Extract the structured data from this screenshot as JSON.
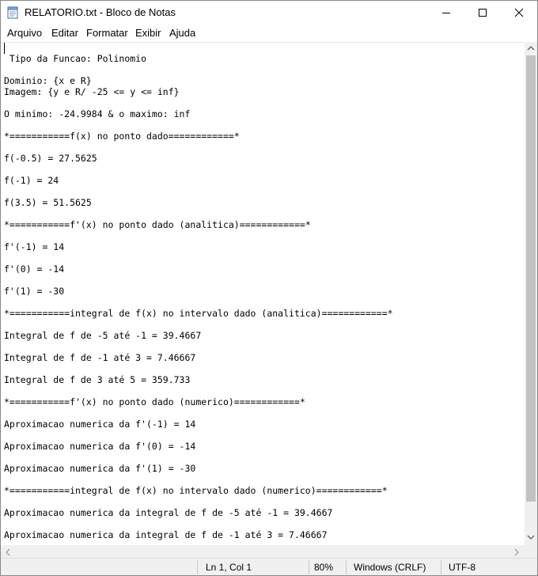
{
  "window": {
    "title": "RELATORIO.txt - Bloco de Notas",
    "icon": "notepad-icon",
    "controls": [
      "minimize-icon",
      "maximize-icon",
      "close-icon"
    ]
  },
  "menu": [
    "Arquivo",
    "Editar",
    "Formatar",
    "Exibir",
    "Ajuda"
  ],
  "editor": {
    "lines": [
      " Tipo da Funcao: Polinomio",
      "Dominio: {x e R}",
      "Imagem: {y e R/ -25 <= y <= inf}",
      "O minimo: -24.9984 & o maximo: inf",
      "*===========f(x) no ponto dado============*",
      "f(-0.5) = 27.5625",
      "f(-1) = 24",
      "f(3.5) = 51.5625",
      "*===========f'(x) no ponto dado (analitica)============*",
      "f'(-1) = 14",
      "f'(0) = -14",
      "f'(1) = -30",
      "*===========integral de f(x) no intervalo dado (analitica)============*",
      "Integral de f de -5 até -1 = 39.4667",
      "Integral de f de -1 até 3 = 7.46667",
      "Integral de f de 3 até 5 = 359.733",
      "*===========f'(x) no ponto dado (numerico)============*",
      "Aproximacao numerica da f'(-1) = 14",
      "Aproximacao numerica da f'(0) = -14",
      "Aproximacao numerica da f'(1) = -30",
      "*===========integral de f(x) no intervalo dado (numerico)============*",
      "Aproximacao numerica da integral de f de -5 até -1 = 39.4667",
      "Aproximacao numerica da integral de f de -1 até 3 = 7.46667"
    ]
  },
  "status": {
    "position": "Ln 1, Col 1",
    "zoom": "80%",
    "line_ending": "Windows (CRLF)",
    "encoding": "UTF-8"
  }
}
